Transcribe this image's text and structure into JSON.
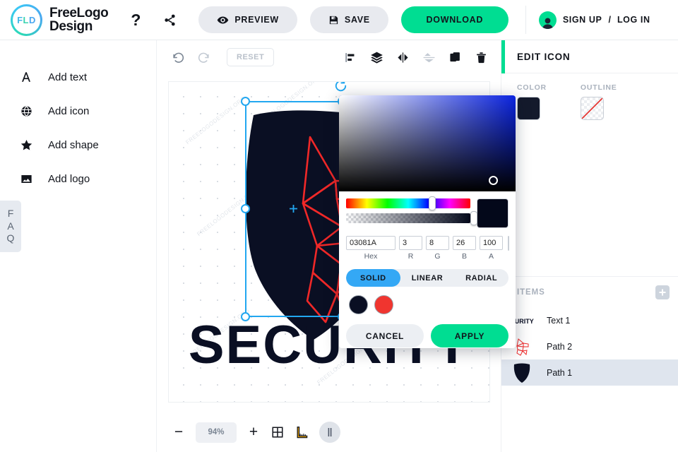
{
  "header": {
    "brand_mark": "FLD",
    "brand_name_line1": "FreeLogo",
    "brand_name_line2": "Design",
    "help_label": "?",
    "help_icon": "question-mark-icon",
    "share_icon": "share-icon",
    "preview_label": "PREVIEW",
    "preview_icon": "eye-icon",
    "save_label": "SAVE",
    "save_icon": "floppy-disk-icon",
    "download_label": "DOWNLOAD",
    "sign_up_label": "SIGN UP",
    "separator": "/",
    "log_in_label": "LOG IN",
    "avatar_icon": "user-avatar-icon",
    "accent_color": "#00dd92"
  },
  "sidebar": {
    "items": [
      {
        "label": "Add text",
        "icon": "letter-a-icon"
      },
      {
        "label": "Add icon",
        "icon": "globe-icon"
      },
      {
        "label": "Add shape",
        "icon": "star-icon"
      },
      {
        "label": "Add logo",
        "icon": "image-icon"
      }
    ],
    "faq_letters": [
      "F",
      "A",
      "Q"
    ]
  },
  "canvas_toolbar": {
    "undo_icon": "undo-arrow-icon",
    "redo_icon": "redo-arrow-icon",
    "reset_label": "RESET",
    "tools": [
      {
        "name": "align-icon",
        "disabled": false
      },
      {
        "name": "layers-icon",
        "disabled": false
      },
      {
        "name": "flip-horizontal-icon",
        "disabled": false
      },
      {
        "name": "flip-vertical-icon",
        "disabled": true
      },
      {
        "name": "duplicate-icon",
        "disabled": false
      },
      {
        "name": "trash-icon",
        "disabled": false
      }
    ]
  },
  "canvas": {
    "logo_text": "SECURITY",
    "watermark_text": "FREELOGODESIGN.ORG",
    "shield_color": "#0a0f23",
    "wolf_color": "#f02828",
    "selection_color": "#22a7f0"
  },
  "zoom_bar": {
    "minus_label": "−",
    "zoom_level": "94%",
    "plus_label": "+",
    "grid_icon": "grid-icon",
    "ruler_icon": "ruler-icon",
    "guides_icon": "guides-icon"
  },
  "right_panel": {
    "title": "EDIT ICON",
    "color_label": "COLOR",
    "color_value": "#03081A",
    "outline_label": "OUTLINE",
    "outline_value": "none",
    "items_label": "ITEMS",
    "add_item_icon": "plus-icon",
    "items": [
      {
        "name": "Text 1",
        "thumb": "text-thumbnail",
        "selected": false
      },
      {
        "name": "Path 2",
        "thumb": "wolf-path-thumbnail",
        "selected": false
      },
      {
        "name": "Path 1",
        "thumb": "shield-path-thumbnail",
        "selected": true
      }
    ]
  },
  "color_picker": {
    "hex_value": "03081A",
    "hex_label": "Hex",
    "r_value": "3",
    "r_label": "R",
    "g_value": "8",
    "g_label": "G",
    "b_value": "26",
    "b_label": "B",
    "a_value": "100",
    "a_label": "A",
    "no_color_icon": "no-color-icon",
    "preview_color": "#03081a",
    "modes": [
      {
        "label": "SOLID",
        "active": true
      },
      {
        "label": "LINEAR",
        "active": false
      },
      {
        "label": "RADIAL",
        "active": false
      }
    ],
    "saved_swatches": [
      "#0a0f23",
      "#f0352f"
    ],
    "cancel_label": "CANCEL",
    "apply_label": "APPLY",
    "active_tab_color": "#34a8f5",
    "apply_color": "#00dd92"
  }
}
